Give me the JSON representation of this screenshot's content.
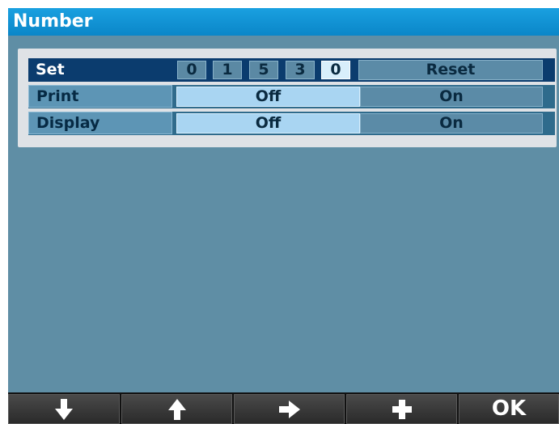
{
  "window": {
    "title": "Number"
  },
  "settings": {
    "set": {
      "label": "Set",
      "digits": [
        "0",
        "1",
        "5",
        "3",
        "0"
      ],
      "active_digit_index": 4,
      "reset_label": "Reset"
    },
    "print": {
      "label": "Print",
      "options": [
        "Off",
        "On"
      ],
      "selected": "Off"
    },
    "display": {
      "label": "Display",
      "options": [
        "Off",
        "On"
      ],
      "selected": "Off"
    }
  },
  "softkeys": [
    {
      "icon": "arrow-down-icon"
    },
    {
      "icon": "arrow-up-icon"
    },
    {
      "icon": "arrow-right-icon"
    },
    {
      "icon": "plus-icon"
    },
    {
      "label": "OK"
    }
  ],
  "colors": {
    "title_bar": "#0a86c8",
    "background": "#5f8ea5",
    "selected_option": "#a9d5f2",
    "set_row": "#0b3c6e"
  }
}
